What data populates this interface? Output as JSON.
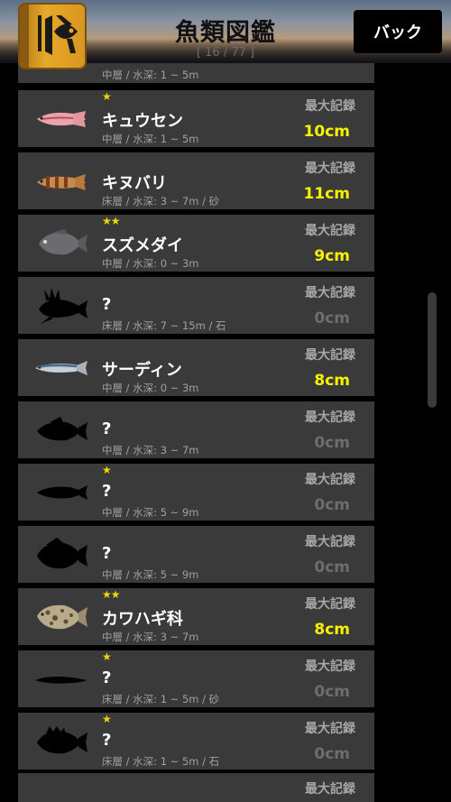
{
  "header": {
    "title": "魚類図鑑",
    "counter": "[ 16 / 77 ]",
    "back_label": "バック"
  },
  "colors": {
    "row_bg": "#3a3a3a",
    "record_value": "#f7f200",
    "record_zero": "#6d6d6d"
  },
  "rows": [
    {
      "stars": "",
      "name": "",
      "habitat": "中層 / 水深: 1 ~ 5m",
      "record_label": "最大記録",
      "record": "",
      "icon": "partial-fish-icon",
      "discovered": false
    },
    {
      "stars": "★",
      "name": "キュウセン",
      "habitat": "中層 / 水深: 1 ~ 5m",
      "record_label": "最大記録",
      "record": "10cm",
      "icon": "kyusen-fish-icon",
      "discovered": true
    },
    {
      "stars": "",
      "name": "キヌバリ",
      "habitat": "床層 / 水深: 3 ~ 7m / 砂",
      "record_label": "最大記録",
      "record": "11cm",
      "icon": "kinubari-fish-icon",
      "discovered": true
    },
    {
      "stars": "★★",
      "name": "スズメダイ",
      "habitat": "中層 / 水深: 0 ~ 3m",
      "record_label": "最大記録",
      "record": "9cm",
      "icon": "suzumedai-fish-icon",
      "discovered": true
    },
    {
      "stars": "",
      "name": "?",
      "habitat": "床層 / 水深: 7 ~ 15m / 石",
      "record_label": "最大記録",
      "record": "0cm",
      "icon": "lionfish-silhouette-icon",
      "discovered": false
    },
    {
      "stars": "",
      "name": "サーディン",
      "habitat": "中層 / 水深: 0 ~ 3m",
      "record_label": "最大記録",
      "record": "8cm",
      "icon": "sardine-fish-icon",
      "discovered": true
    },
    {
      "stars": "",
      "name": "?",
      "habitat": "中層 / 水深: 3 ~ 7m",
      "record_label": "最大記録",
      "record": "0cm",
      "icon": "fish-silhouette-icon",
      "discovered": false
    },
    {
      "stars": "★",
      "name": "?",
      "habitat": "中層 / 水深: 5 ~ 9m",
      "record_label": "最大記録",
      "record": "0cm",
      "icon": "fish-silhouette-icon",
      "discovered": false
    },
    {
      "stars": "",
      "name": "?",
      "habitat": "中層 / 水深: 5 ~ 9m",
      "record_label": "最大記録",
      "record": "0cm",
      "icon": "fish-silhouette-icon",
      "discovered": false
    },
    {
      "stars": "★★",
      "name": "カワハギ科",
      "habitat": "中層 / 水深: 3 ~ 7m",
      "record_label": "最大記録",
      "record": "8cm",
      "icon": "filefish-icon",
      "discovered": true
    },
    {
      "stars": "★",
      "name": "?",
      "habitat": "床層 / 水深: 1 ~ 5m / 砂",
      "record_label": "最大記録",
      "record": "0cm",
      "icon": "eel-silhouette-icon",
      "discovered": false
    },
    {
      "stars": "★",
      "name": "?",
      "habitat": "床層 / 水深: 1 ~ 5m / 石",
      "record_label": "最大記録",
      "record": "0cm",
      "icon": "rockfish-silhouette-icon",
      "discovered": false
    },
    {
      "stars": "",
      "name": "",
      "habitat": "",
      "record_label": "最大記録",
      "record": "",
      "icon": "",
      "discovered": false
    }
  ]
}
